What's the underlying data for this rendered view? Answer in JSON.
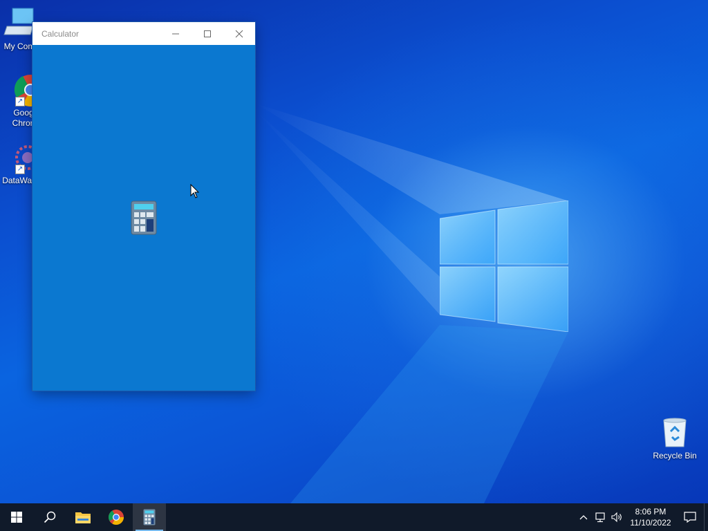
{
  "desktop": {
    "icons": [
      {
        "label": "My Com",
        "icon": "computer-icon"
      },
      {
        "label": "Goog Chron",
        "icon": "chrome-icon"
      },
      {
        "label": "DataWag",
        "icon": "datawag-icon"
      },
      {
        "label": "Recycle Bin",
        "icon": "recycle-bin-icon"
      }
    ]
  },
  "calculator_window": {
    "title": "Calculator",
    "background": "#0b78d0",
    "controls": [
      "minimize-icon",
      "maximize-icon",
      "close-icon"
    ],
    "splash_icon": "calculator-icon"
  },
  "taskbar": {
    "items": [
      {
        "name": "start",
        "icon": "windows-start-icon"
      },
      {
        "name": "search",
        "icon": "search-icon"
      },
      {
        "name": "file-explorer",
        "icon": "folder-icon"
      },
      {
        "name": "chrome",
        "icon": "chrome-icon"
      },
      {
        "name": "calculator",
        "icon": "calculator-icon",
        "active": true
      }
    ],
    "tray": {
      "time": "8:06 PM",
      "date": "11/10/2022",
      "icons": [
        "chevron-up-icon",
        "network-icon",
        "volume-icon",
        "notification-icon"
      ]
    }
  },
  "colors": {
    "accent": "#0b78d0",
    "taskbar": "#101a2a"
  }
}
